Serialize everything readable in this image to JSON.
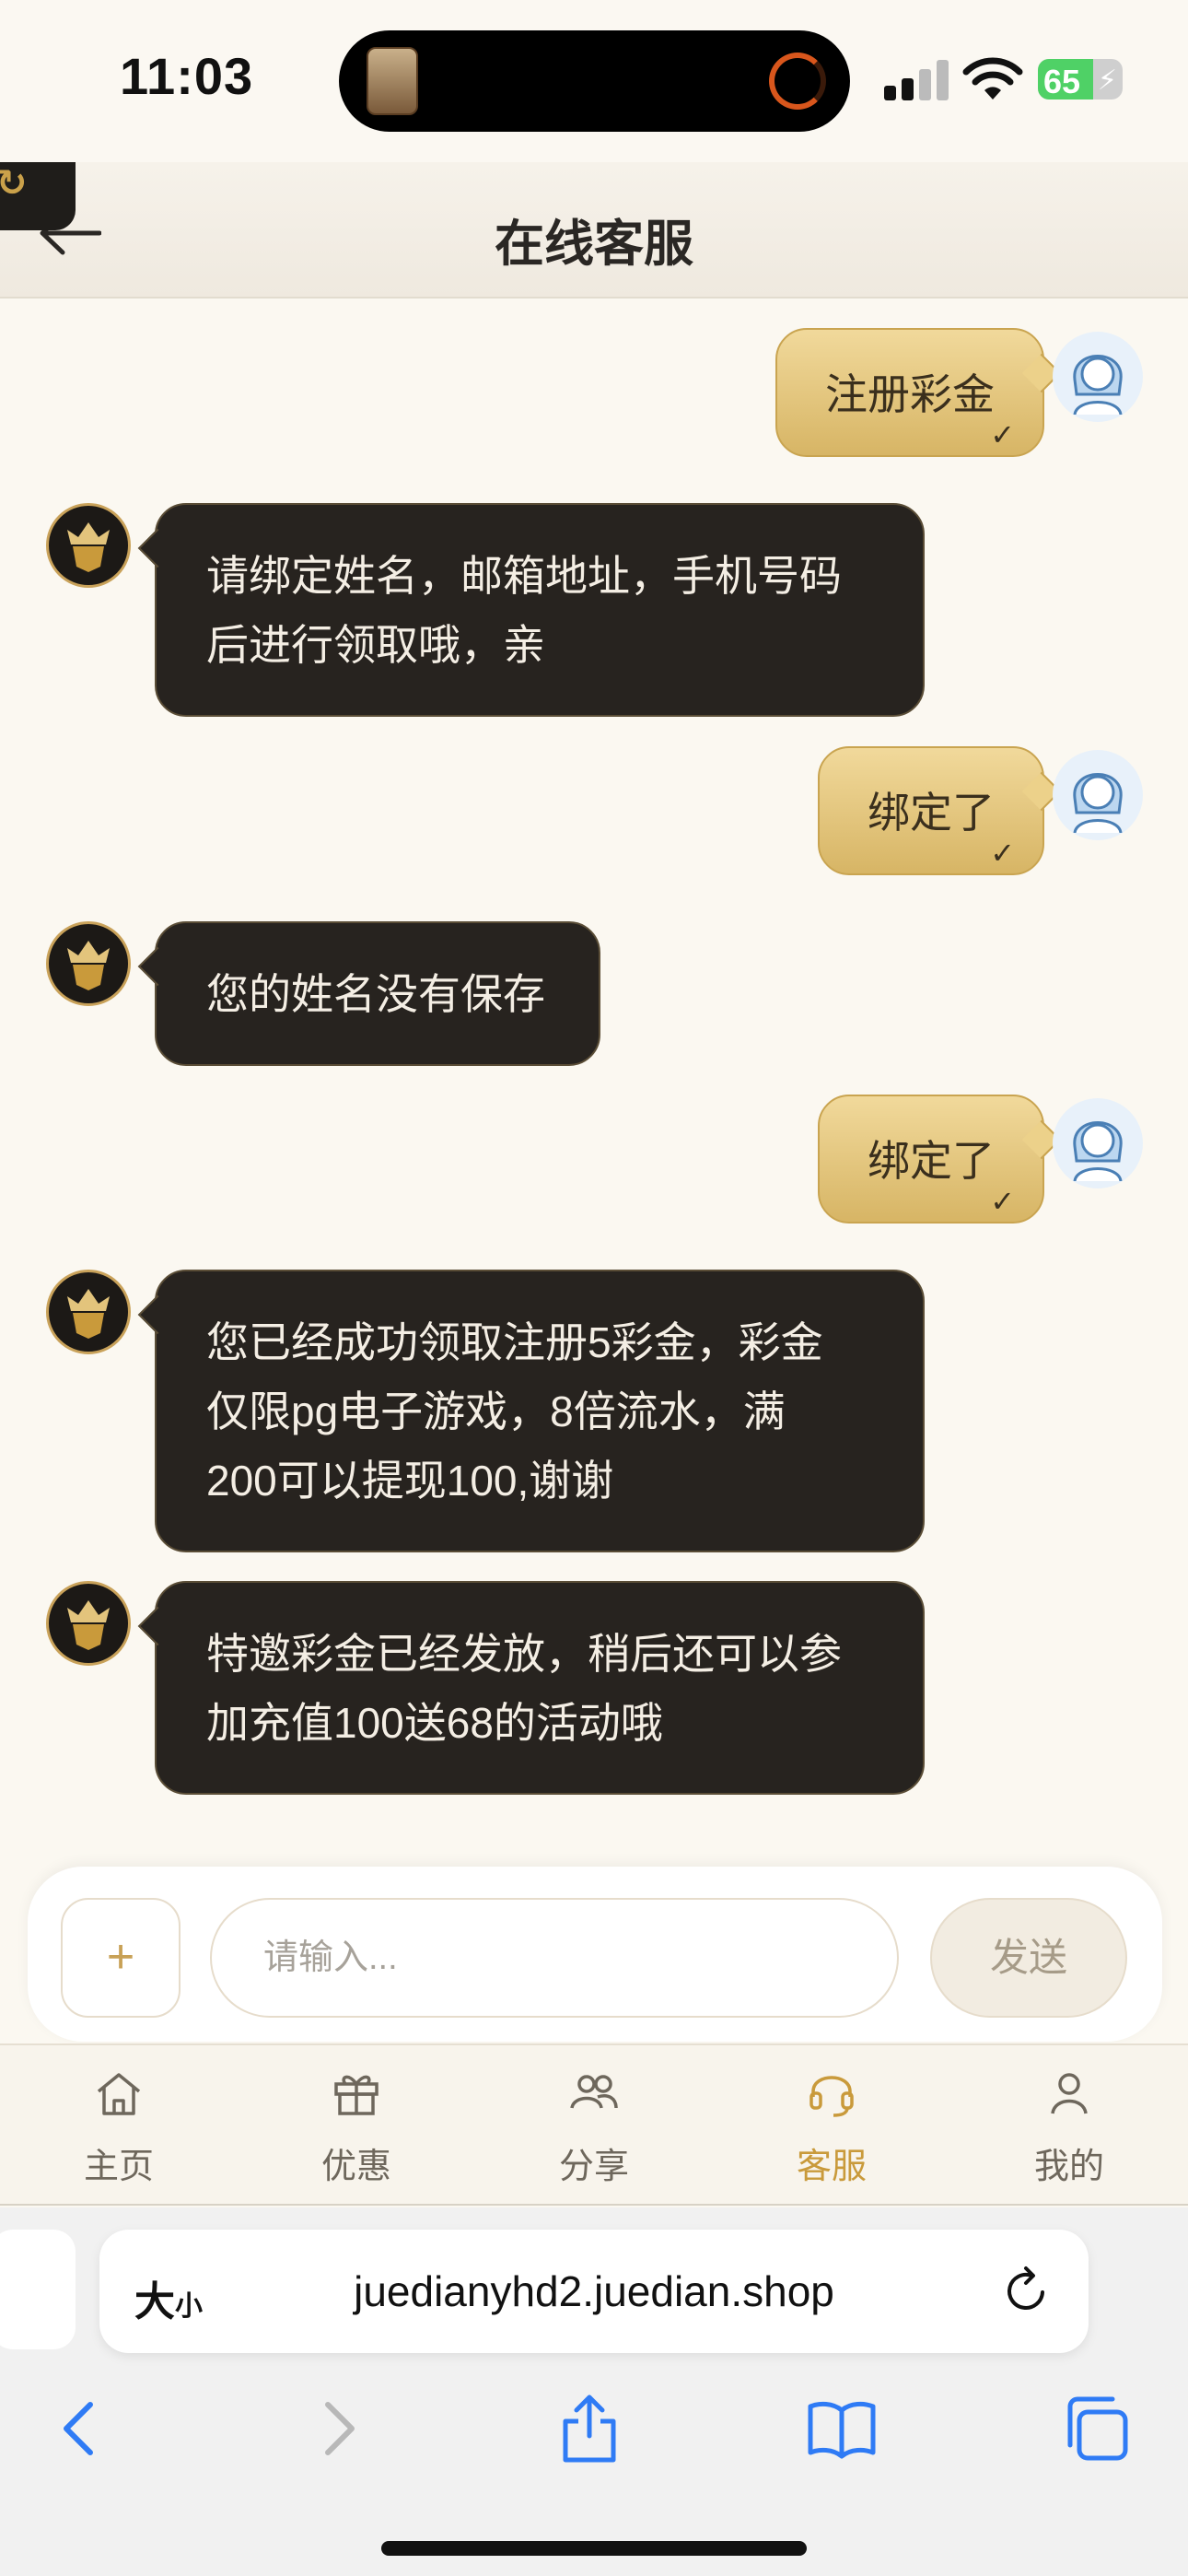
{
  "status_bar": {
    "time": "11:03",
    "battery": "65",
    "battery_level": 0.65
  },
  "header": {
    "title": "在线客服"
  },
  "messages": [
    {
      "side": "user",
      "text": "注册彩金"
    },
    {
      "side": "bot",
      "lines": [
        "请绑定姓名，邮箱地址，手机号码",
        "后进行领取哦，亲"
      ]
    },
    {
      "side": "user",
      "text": "绑定了"
    },
    {
      "side": "bot",
      "lines": [
        "您的姓名没有保存"
      ]
    },
    {
      "side": "user",
      "text": "绑定了"
    },
    {
      "side": "bot",
      "lines": [
        "您已经成功领取注册5彩金，彩金",
        "仅限pg电子游戏，8倍流水，满",
        "200可以提现100,谢谢"
      ]
    },
    {
      "side": "bot",
      "lines": [
        "特邀彩金已经发放，稍后还可以参",
        "加充值100送68的活动哦"
      ]
    }
  ],
  "input": {
    "plus": "+",
    "placeholder": "请输入...",
    "send": "发送"
  },
  "nav": {
    "items": [
      {
        "label": "主页",
        "icon": "home-icon"
      },
      {
        "label": "优惠",
        "icon": "gift-icon"
      },
      {
        "label": "分享",
        "icon": "users-icon"
      },
      {
        "label": "客服",
        "icon": "headset-icon",
        "active": true
      },
      {
        "label": "我的",
        "icon": "person-icon"
      }
    ]
  },
  "browser": {
    "aa_big": "大",
    "aa_small": "小",
    "url": "juedianyhd2.juedian.shop"
  },
  "colors": {
    "accent_gold": "#c99a3b",
    "bubble_dark": "#27231f",
    "bubble_gold": "#e3c47c"
  }
}
